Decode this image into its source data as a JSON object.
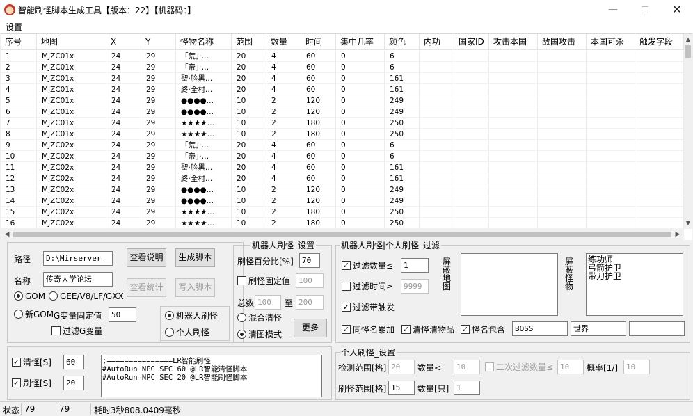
{
  "window": {
    "title": "智能刷怪脚本生成工具【版本：22】【机器码：】",
    "min_glyph": "—",
    "close_glyph": "✕"
  },
  "menu": {
    "settings": "设置"
  },
  "table": {
    "columns": [
      "序号",
      "地图",
      "X",
      "Y",
      "怪物名称",
      "范围",
      "数量",
      "时间",
      "集中几率",
      "颜色",
      "内功",
      "国家ID",
      "攻击本国",
      "敌国攻击",
      "本国可杀",
      "触发字段"
    ],
    "rows": [
      [
        "1",
        "MJZC01x",
        "24",
        "29",
        "「荒」·…",
        "20",
        "4",
        "60",
        "0",
        "6"
      ],
      [
        "2",
        "MJZC01x",
        "24",
        "29",
        "「帝」·…",
        "20",
        "4",
        "60",
        "0",
        "6"
      ],
      [
        "3",
        "MJZC01x",
        "24",
        "29",
        "聖·脸黑…",
        "20",
        "4",
        "60",
        "0",
        "161"
      ],
      [
        "4",
        "MJZC01x",
        "24",
        "29",
        "終·全村…",
        "20",
        "4",
        "60",
        "0",
        "161"
      ],
      [
        "5",
        "MJZC01x",
        "24",
        "29",
        "●●●●…",
        "10",
        "2",
        "120",
        "0",
        "249"
      ],
      [
        "6",
        "MJZC01x",
        "24",
        "29",
        "●●●●…",
        "10",
        "2",
        "120",
        "0",
        "249"
      ],
      [
        "7",
        "MJZC01x",
        "24",
        "29",
        "★★★★…",
        "10",
        "2",
        "180",
        "0",
        "250"
      ],
      [
        "8",
        "MJZC01x",
        "24",
        "29",
        "★★★★…",
        "10",
        "2",
        "180",
        "0",
        "250"
      ],
      [
        "9",
        "MJZC02x",
        "24",
        "29",
        "「荒」·…",
        "20",
        "4",
        "60",
        "0",
        "6"
      ],
      [
        "10",
        "MJZC02x",
        "24",
        "29",
        "「帝」·…",
        "20",
        "4",
        "60",
        "0",
        "6"
      ],
      [
        "11",
        "MJZC02x",
        "24",
        "29",
        "聖·脸黑…",
        "20",
        "4",
        "60",
        "0",
        "161"
      ],
      [
        "12",
        "MJZC02x",
        "24",
        "29",
        "終·全村…",
        "20",
        "4",
        "60",
        "0",
        "161"
      ],
      [
        "13",
        "MJZC02x",
        "24",
        "29",
        "●●●●…",
        "10",
        "2",
        "120",
        "0",
        "249"
      ],
      [
        "14",
        "MJZC02x",
        "24",
        "29",
        "●●●●…",
        "10",
        "2",
        "120",
        "0",
        "249"
      ],
      [
        "15",
        "MJZC02x",
        "24",
        "29",
        "★★★★…",
        "10",
        "2",
        "180",
        "0",
        "250"
      ],
      [
        "16",
        "MJZC02x",
        "24",
        "29",
        "★★★★…",
        "10",
        "2",
        "180",
        "0",
        "250"
      ]
    ]
  },
  "config": {
    "path_label": "路径",
    "path_value": "D:\\Mirserver",
    "name_label": "名称",
    "name_value": "传奇大学论坛",
    "view_readme": "查看说明",
    "generate": "生成脚本",
    "view_stats": "查看统计",
    "write_script": "写入脚本",
    "gom": "GOM",
    "gee": "GEE/V8/LF/GXX",
    "new_gom": "新GOM",
    "g_var_fixed": "G变量固定值",
    "g_var_value": "50",
    "filter_g_var": "过滤G变量",
    "robot_mode": "机器人刷怪",
    "personal_mode": "个人刷怪"
  },
  "robot_settings": {
    "legend": "机器人刷怪_设置",
    "percent_label": "刷怪百分比[%]",
    "percent_value": "70",
    "fixed_label": "刷怪固定值",
    "fixed_value": "100",
    "total_label": "总数",
    "total_min": "100",
    "to_label": "至",
    "total_max": "200",
    "mixed_clear": "混合清怪",
    "clear_map": "清图模式",
    "more": "更多"
  },
  "filter": {
    "legend": "机器人刷怪|个人刷怪_过滤",
    "filter_count": "过滤数量≤",
    "filter_count_value": "1",
    "filter_time": "过滤时间≥",
    "filter_time_value": "9999",
    "filter_trigger": "过滤带触发",
    "shield_map": "屏蔽地图",
    "shield_monster": "屏蔽怪物",
    "monster_list": [
      "练功师",
      "弓箭护卫",
      "带刀护卫"
    ],
    "same_name": "同怪名累加",
    "clear_items": "清怪清物品",
    "name_contains": "怪名包含",
    "contains_1": "BOSS",
    "contains_2": "世界",
    "contains_3": ""
  },
  "timers": {
    "clear_label": "清怪[S]",
    "clear_value": "60",
    "spawn_label": "刷怪[S]",
    "spawn_value": "20",
    "script_lines": [
      ";===============LR智能刷怪",
      "#AutoRun NPC SEC 60 @LR智能清怪脚本",
      "#AutoRun NPC SEC 20 @LR智能刷怪脚本"
    ]
  },
  "personal": {
    "legend": "个人刷怪_设置",
    "detect_label": "检测范围[格]",
    "detect_value": "20",
    "count_label": "数量<",
    "count_value": "10",
    "second_filter": "二次过滤数量≤",
    "second_value": "10",
    "prob_label": "概率[1/]",
    "prob_value": "10",
    "spawn_range_label": "刷怪范围[格]",
    "spawn_range_value": "15",
    "count_only_label": "数量[只]",
    "count_only_value": "1"
  },
  "status": {
    "label": "状态",
    "v1": "79",
    "v2": "79",
    "elapsed": "耗时3秒808.0409毫秒"
  }
}
